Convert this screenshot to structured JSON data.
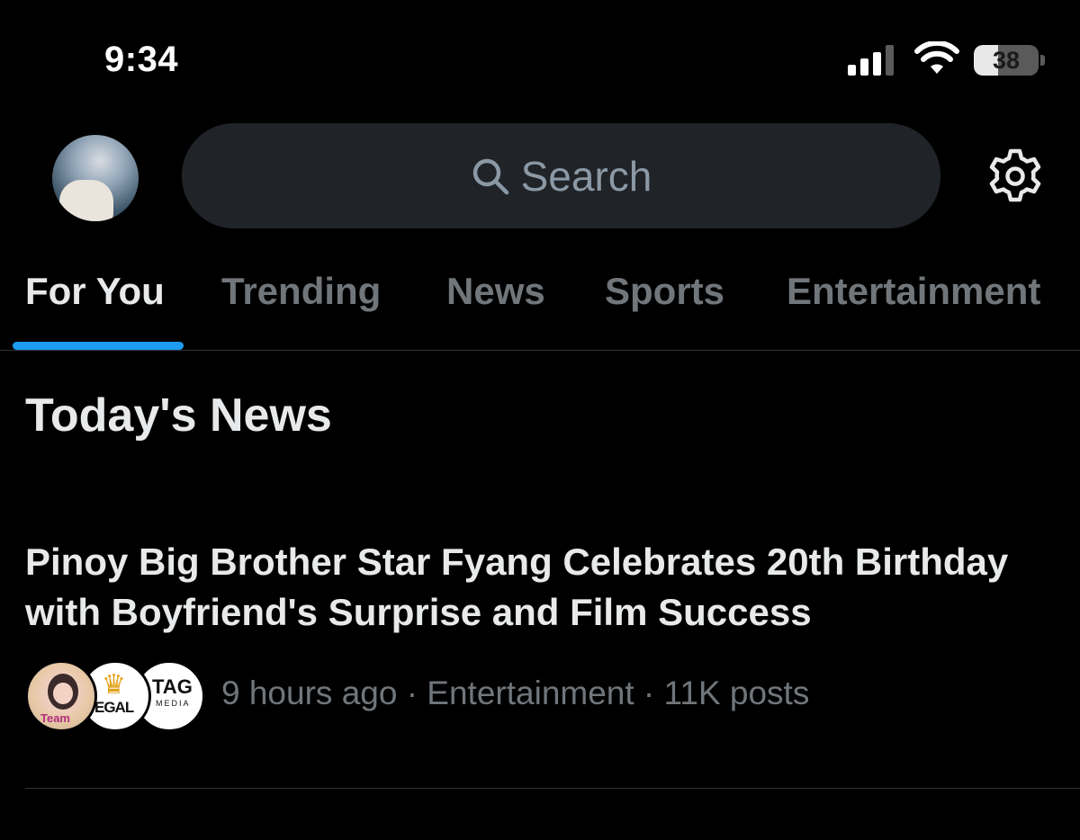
{
  "status_bar": {
    "time": "9:34",
    "battery_level": "38",
    "battery_fraction": 0.38
  },
  "header": {
    "search_placeholder": "Search",
    "avatar_icon": "profile-avatar",
    "settings_icon": "gear-icon"
  },
  "tabs": [
    {
      "label": "For You",
      "active": true
    },
    {
      "label": "Trending",
      "active": false
    },
    {
      "label": "News",
      "active": false
    },
    {
      "label": "Sports",
      "active": false
    },
    {
      "label": "Entertainment",
      "active": false
    }
  ],
  "section": {
    "title": "Today's News"
  },
  "stories": [
    {
      "headline": "Pinoy Big Brother Star Fyang Celebrates 20th Birthday with Boyfriend's Surprise and Film Success",
      "meta": "9 hours ago · Entertainment · 11K posts",
      "publisher_logos": [
        {
          "label": "Team"
        },
        {
          "label": "EGAL"
        },
        {
          "label": "TAG",
          "sub": "MEDIA"
        }
      ]
    }
  ],
  "colors": {
    "background": "#000000",
    "accent": "#1d9bf0",
    "primary_text": "#e7e9ea",
    "secondary_text": "#71767b",
    "search_bg": "#202327"
  }
}
